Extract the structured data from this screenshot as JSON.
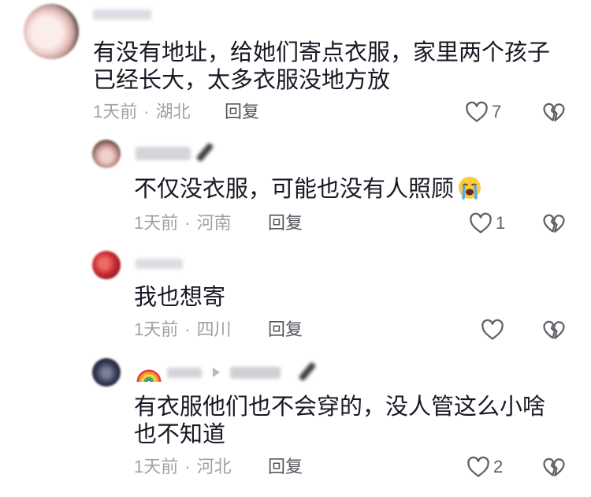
{
  "meta_separator": "·",
  "colors": {
    "text": "#161823",
    "meta": "#a0a0a6",
    "reply_button": "#55555d",
    "icon": "#5f5f66"
  },
  "icons": {
    "like": "heart-outline-icon",
    "dislike": "broken-heart-icon",
    "reply_to": "caret-right-icon",
    "text_emoji": "loudly-crying-face-icon",
    "name_emoji": "rainbow-icon"
  },
  "comment": {
    "lines": [
      "有没有地址，给她们寄点衣服，家里两个孩子",
      "已经长大，太多衣服没地方放"
    ],
    "time": "1天前",
    "location": "湖北",
    "reply_label": "回复",
    "likes": 7
  },
  "replies": [
    {
      "lines": [
        "不仅没衣服，可能也没有人照顾"
      ],
      "time": "1天前",
      "location": "河南",
      "reply_label": "回复",
      "likes": 1
    },
    {
      "lines": [
        "我也想寄"
      ],
      "time": "1天前",
      "location": "四川",
      "reply_label": "回复"
    },
    {
      "lines": [
        "有衣服他们也不会穿的，没人管这么小啥",
        "也不知道"
      ],
      "time": "1天前",
      "location": "河北",
      "reply_label": "回复",
      "likes": 2
    }
  ]
}
